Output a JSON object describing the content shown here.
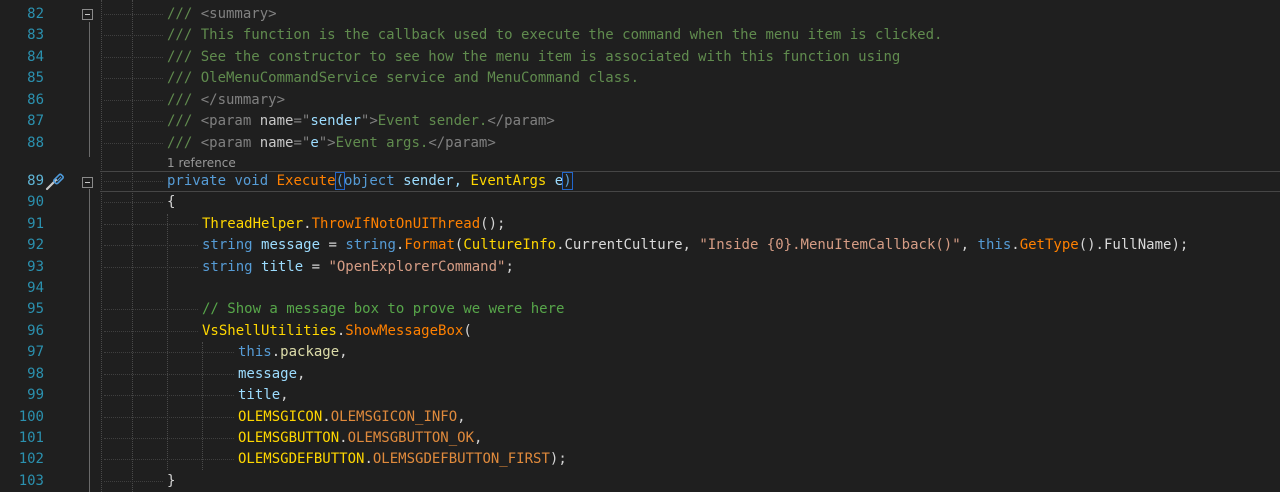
{
  "codelens": {
    "references": "1 reference"
  },
  "tip_icon": "screwdriver-icon",
  "colors": {
    "background": "#1f1f1f",
    "line_number": "#2b91af",
    "comment": "#57a64a",
    "keyword": "#569cd6",
    "type": "#ffd700",
    "method": "#ff8000",
    "string": "#d69d85"
  },
  "lines": [
    {
      "n": "82",
      "indent": 2,
      "tokens": [
        [
          "doc",
          "/// "
        ],
        [
          "tag",
          "<summary>"
        ]
      ]
    },
    {
      "n": "83",
      "indent": 2,
      "tokens": [
        [
          "doc",
          "/// This function is the callback used to execute the command when the menu item is clicked."
        ]
      ]
    },
    {
      "n": "84",
      "indent": 2,
      "tokens": [
        [
          "doc",
          "/// See the constructor to see how the menu item is associated with this function using"
        ]
      ]
    },
    {
      "n": "85",
      "indent": 2,
      "tokens": [
        [
          "doc",
          "/// OleMenuCommandService service and MenuCommand class."
        ]
      ]
    },
    {
      "n": "86",
      "indent": 2,
      "tokens": [
        [
          "doc",
          "/// "
        ],
        [
          "tag",
          "</summary>"
        ]
      ]
    },
    {
      "n": "87",
      "indent": 2,
      "tokens": [
        [
          "doc",
          "/// "
        ],
        [
          "tag",
          "<param "
        ],
        [
          "attr",
          "name"
        ],
        [
          "tag",
          "=\""
        ],
        [
          "par",
          "sender"
        ],
        [
          "tag",
          "\">"
        ],
        [
          "doc",
          "Event sender."
        ],
        [
          "tag",
          "</param>"
        ]
      ]
    },
    {
      "n": "88",
      "indent": 2,
      "tokens": [
        [
          "doc",
          "/// "
        ],
        [
          "tag",
          "<param "
        ],
        [
          "attr",
          "name"
        ],
        [
          "tag",
          "=\""
        ],
        [
          "par",
          "e"
        ],
        [
          "tag",
          "\">"
        ],
        [
          "doc",
          "Event args."
        ],
        [
          "tag",
          "</param>"
        ]
      ]
    },
    {
      "n": "89",
      "indent": 2,
      "tokens": [
        [
          "kw",
          "private "
        ],
        [
          "kw",
          "void "
        ],
        [
          "meth",
          "Execute"
        ],
        [
          "br",
          "("
        ],
        [
          "kw",
          "object "
        ],
        [
          "par",
          "sender, "
        ],
        [
          "type",
          "EventArgs "
        ],
        [
          "par",
          "e"
        ],
        [
          "br",
          ")"
        ]
      ]
    },
    {
      "n": "90",
      "indent": 2,
      "tokens": [
        [
          "plain",
          "{"
        ]
      ]
    },
    {
      "n": "91",
      "indent": 3,
      "tokens": [
        [
          "type",
          "ThreadHelper"
        ],
        [
          "plain",
          "."
        ],
        [
          "meth",
          "ThrowIfNotOnUIThread"
        ],
        [
          "plain",
          "();"
        ]
      ]
    },
    {
      "n": "92",
      "indent": 3,
      "tokens": [
        [
          "kw",
          "string "
        ],
        [
          "par",
          "message "
        ],
        [
          "plain",
          "= "
        ],
        [
          "kw",
          "string"
        ],
        [
          "plain",
          "."
        ],
        [
          "meth",
          "Format"
        ],
        [
          "plain",
          "("
        ],
        [
          "type",
          "CultureInfo"
        ],
        [
          "plain",
          "."
        ],
        [
          "prop",
          "CurrentCulture"
        ],
        [
          "plain",
          ", "
        ],
        [
          "str",
          "\"Inside {0}.MenuItemCallback()\""
        ],
        [
          "plain",
          ", "
        ],
        [
          "kw",
          "this"
        ],
        [
          "plain",
          "."
        ],
        [
          "meth",
          "GetType"
        ],
        [
          "plain",
          "()."
        ],
        [
          "prop",
          "FullName"
        ],
        [
          "plain",
          ");"
        ]
      ]
    },
    {
      "n": "93",
      "indent": 3,
      "tokens": [
        [
          "kw",
          "string "
        ],
        [
          "par",
          "title "
        ],
        [
          "plain",
          "= "
        ],
        [
          "str",
          "\"OpenExplorerCommand\""
        ],
        [
          "plain",
          ";"
        ]
      ]
    },
    {
      "n": "94",
      "indent": 0,
      "tokens": []
    },
    {
      "n": "95",
      "indent": 3,
      "tokens": [
        [
          "com",
          "// Show a message box to prove we were here"
        ]
      ]
    },
    {
      "n": "96",
      "indent": 3,
      "tokens": [
        [
          "type",
          "VsShellUtilities"
        ],
        [
          "plain",
          "."
        ],
        [
          "meth",
          "ShowMessageBox"
        ],
        [
          "plain",
          "("
        ]
      ]
    },
    {
      "n": "97",
      "indent": 4,
      "tokens": [
        [
          "kw",
          "this"
        ],
        [
          "plain",
          "."
        ],
        [
          "fld",
          "package"
        ],
        [
          "plain",
          ","
        ]
      ]
    },
    {
      "n": "98",
      "indent": 4,
      "tokens": [
        [
          "par",
          "message"
        ],
        [
          "plain",
          ","
        ]
      ]
    },
    {
      "n": "99",
      "indent": 4,
      "tokens": [
        [
          "par",
          "title"
        ],
        [
          "plain",
          ","
        ]
      ]
    },
    {
      "n": "100",
      "indent": 4,
      "tokens": [
        [
          "type",
          "OLEMSGICON"
        ],
        [
          "plain",
          "."
        ],
        [
          "enumv",
          "OLEMSGICON_INFO"
        ],
        [
          "plain",
          ","
        ]
      ]
    },
    {
      "n": "101",
      "indent": 4,
      "tokens": [
        [
          "type",
          "OLEMSGBUTTON"
        ],
        [
          "plain",
          "."
        ],
        [
          "enumv",
          "OLEMSGBUTTON_OK"
        ],
        [
          "plain",
          ","
        ]
      ]
    },
    {
      "n": "102",
      "indent": 4,
      "tokens": [
        [
          "type",
          "OLEMSGDEFBUTTON"
        ],
        [
          "plain",
          "."
        ],
        [
          "enumv",
          "OLEMSGDEFBUTTON_FIRST"
        ],
        [
          "plain",
          ");"
        ]
      ]
    },
    {
      "n": "103",
      "indent": 2,
      "tokens": [
        [
          "plain",
          "}"
        ]
      ]
    }
  ]
}
